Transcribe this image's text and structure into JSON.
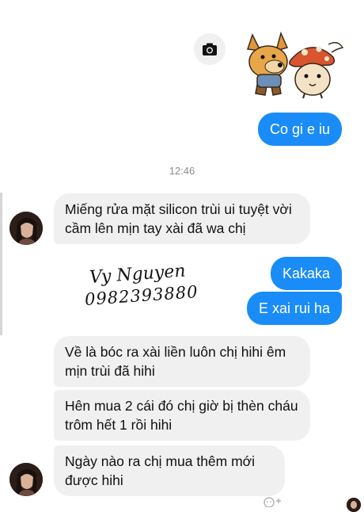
{
  "timestamp": "12:46",
  "outgoing": {
    "msg1": "Co gi e iu",
    "msg2": "Kakaka",
    "msg3": "E xai rui ha"
  },
  "incoming": {
    "msg1": "Miếng rửa mặt silicon trùi ui tuyệt vời cầm lên mịn tay xài đã wa chị",
    "msg2": "Về là bóc ra xài liền luôn chị hihi êm mịn trùi đã hihi",
    "msg3": "Hên mua 2 cái đó chị giờ bị thèn cháu trôm hết 1 rồi hihi",
    "msg4": "Ngày nào ra chị mua thêm mới được hihi"
  },
  "signature": {
    "name": "Vy Nguyen",
    "phone": "0982393880"
  },
  "colors": {
    "outgoing_bubble": "#1a8cf7",
    "incoming_bubble": "#f1f0f0"
  }
}
